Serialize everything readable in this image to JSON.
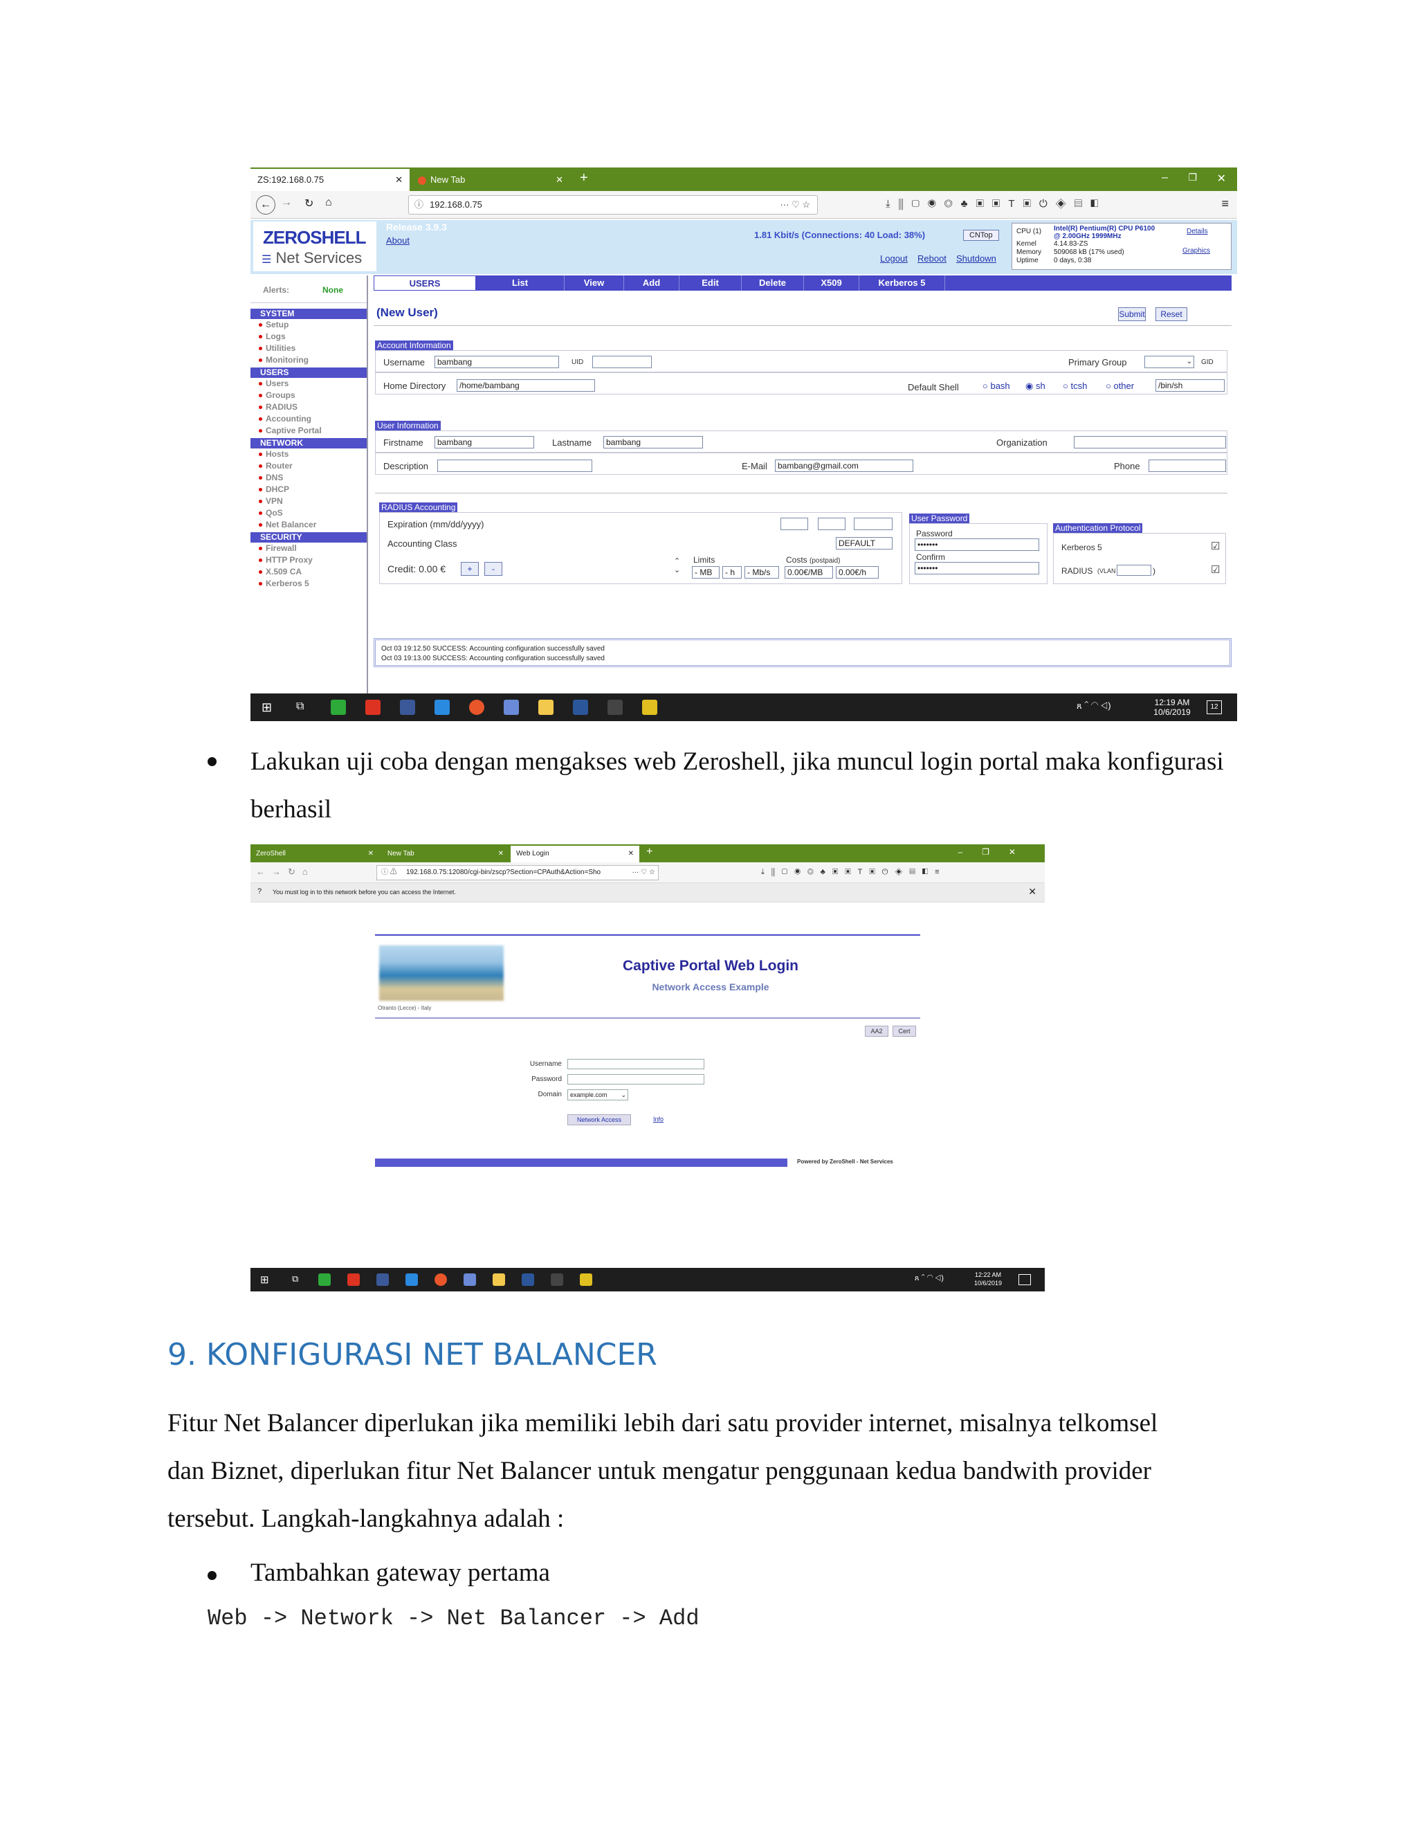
{
  "screenshot1": {
    "tabs": [
      {
        "label": "ZS:192.168.0.75"
      },
      {
        "label": "New Tab"
      }
    ],
    "url": "192.168.0.75",
    "zeroshell": {
      "logo_top": "ZEROSHELL",
      "logo_bottom": "Net Services",
      "release": "Release 3.9.3",
      "about": "About",
      "traffic": "1.81 Kbit/s (Connections: 40 Load: 38%)",
      "cntop": "CNTop",
      "logout": "Logout",
      "reboot": "Reboot",
      "shutdown": "Shutdown",
      "sysinfo": {
        "cpu_label": "CPU (1)",
        "cpu_value": "Intel(R) Pentium(R) CPU P6100 @ 2.00GHz 1999MHz",
        "kernel_label": "Kernel",
        "kernel_value": "4.14.83-ZS",
        "memory_label": "Memory",
        "memory_value": "509068 kB (17% used)",
        "uptime_label": "Uptime",
        "uptime_value": "0 days, 0:38",
        "details": "Details",
        "graphics": "Graphics"
      }
    },
    "sidebar": {
      "alerts_label": "Alerts:",
      "alerts_value": "None",
      "sections": [
        {
          "title": "SYSTEM",
          "items": [
            "Setup",
            "Logs",
            "Utilities",
            "Monitoring"
          ]
        },
        {
          "title": "USERS",
          "items": [
            "Users",
            "Groups",
            "RADIUS",
            "Accounting",
            "Captive Portal"
          ]
        },
        {
          "title": "NETWORK",
          "items": [
            "Hosts",
            "Router",
            "DNS",
            "DHCP",
            "VPN",
            "QoS",
            "Net Balancer"
          ]
        },
        {
          "title": "SECURITY",
          "items": [
            "Firewall",
            "HTTP Proxy",
            "X.509 CA",
            "Kerberos 5"
          ]
        }
      ]
    },
    "menu_tabs": [
      "USERS",
      "List",
      "View",
      "Add",
      "Edit",
      "Delete",
      "X509",
      "Kerberos 5"
    ],
    "form": {
      "heading": "(New User)",
      "submit": "Submit",
      "reset": "Reset",
      "account_info": "Account Information",
      "username_label": "Username",
      "username_value": "bambang",
      "uid_label": "UID",
      "primary_group_label": "Primary Group",
      "gid_label": "GID",
      "home_dir_label": "Home Directory",
      "home_dir_value": "/home/bambang",
      "default_shell_label": "Default Shell",
      "shells": [
        "bash",
        "sh",
        "tcsh",
        "other"
      ],
      "shell_path": "/bin/sh",
      "user_info": "User Information",
      "firstname_label": "Firstname",
      "firstname_value": "bambang",
      "lastname_label": "Lastname",
      "lastname_value": "bambang",
      "organization_label": "Organization",
      "description_label": "Description",
      "email_label": "E-Mail",
      "email_value": "bambang@gmail.com",
      "phone_label": "Phone",
      "radius_accounting": "RADIUS Accounting",
      "expiration_label": "Expiration (mm/dd/yyyy)",
      "accounting_class_label": "Accounting Class",
      "accounting_class_value": "DEFAULT",
      "credit": "Credit: 0.00 €",
      "plus": "+",
      "minus": "-",
      "limits_label": "Limits",
      "limit_mb": "- MB",
      "limit_h": "- h",
      "limit_mbs": "- Mb/s",
      "costs_label": "Costs",
      "costs_note": "(postpaid)",
      "cost_mb": "0.00€/MB",
      "cost_h": "0.00€/h",
      "user_password": "User Password",
      "password_label": "Password",
      "password_value": "•••••••",
      "confirm_label": "Confirm",
      "confirm_value": "•••••••",
      "auth_protocol": "Authentication Protocol",
      "kerberos_label": "Kerberos 5",
      "radius_label": "RADIUS",
      "vlan_label": "(VLAN",
      "vlan_close": ")"
    },
    "log": [
      "Oct 03 19:12.50 SUCCESS: Accounting configuration successfully saved",
      "Oct 03 19:13.00 SUCCESS: Accounting configuration successfully saved"
    ],
    "taskbar": {
      "time": "12:19 AM",
      "date": "10/6/2019",
      "notif": "12"
    }
  },
  "bullet1": "Lakukan uji coba dengan mengakses web Zeroshell, jika muncul login portal maka konfigurasi berhasil",
  "screenshot2": {
    "tabs": [
      {
        "label": "ZeroShell"
      },
      {
        "label": "New Tab"
      },
      {
        "label": "Web Login"
      }
    ],
    "url": "192.168.0.75:12080/cgi-bin/zscp?Section=CPAuth&Action=Sho",
    "notice": "You must log in to this network before you can access the Internet.",
    "portal_title": "Captive Portal Web Login",
    "portal_subtitle": "Network Access Example",
    "photo_caption": "Otranto (Lecce) - Italy",
    "aa2": "AA2",
    "cert": "Cert",
    "username_label": "Username",
    "password_label": "Password",
    "domain_label": "Domain",
    "domain_value": "example.com",
    "network_access": "Network Access",
    "info": "Info",
    "powered": "Powered by ZeroShell - Net Services",
    "taskbar": {
      "time": "12:22 AM",
      "date": "10/6/2019"
    }
  },
  "heading": "9.  KONFIGURASI NET BALANCER",
  "paragraph": [
    "Fitur Net Balancer diperlukan jika memiliki lebih dari satu provider internet, misalnya telkomsel",
    "dan Biznet, diperlukan fitur Net Balancer untuk mengatur penggunaan kedua bandwith provider",
    "tersebut. Langkah-langkahnya adalah :"
  ],
  "bullet2": "Tambahkan gateway pertama",
  "code": "Web -> Network -> Net Balancer -> Add",
  "colors": {
    "heading": "#2e74b5",
    "browser_green": "#5c8a1e",
    "zs_blue": "#4848c8"
  }
}
